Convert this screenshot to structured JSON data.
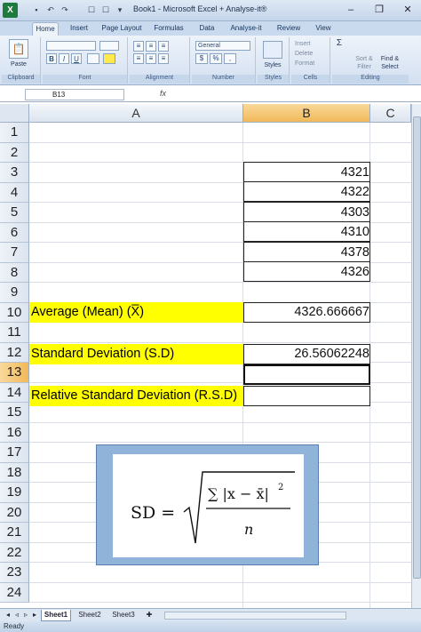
{
  "window": {
    "title": "Book1 - Microsoft Excel + Analyse-it®",
    "logo": "X"
  },
  "ribbon_tabs": [
    "Home",
    "Insert",
    "Page Layout",
    "Formulas",
    "Data",
    "Analyse-it",
    "Review",
    "View"
  ],
  "ribbon": {
    "clipboard": {
      "label": "Clipboard",
      "paste": "Paste"
    },
    "font": {
      "label": "Font",
      "bold": "B",
      "italic": "I",
      "underline": "U"
    },
    "alignment": {
      "label": "Alignment"
    },
    "number": {
      "label": "Number",
      "format": "General"
    },
    "styles": {
      "label": "Styles",
      "button": "Styles"
    },
    "cells": {
      "label": "Cells",
      "insert": "Insert",
      "delete": "Delete",
      "format": "Format"
    },
    "editing": {
      "label": "Editing",
      "sort": "Sort &\nFilter",
      "find": "Find &\nSelect"
    }
  },
  "formula_bar": {
    "name_box": "B13",
    "fx": "fx",
    "content": ""
  },
  "columns": [
    "A",
    "B",
    "C"
  ],
  "rows": [
    "1",
    "2",
    "3",
    "4",
    "5",
    "6",
    "7",
    "8",
    "9",
    "10",
    "11",
    "12",
    "13",
    "14",
    "15",
    "16",
    "17",
    "18",
    "19",
    "20",
    "21",
    "22",
    "23",
    "24"
  ],
  "selected": {
    "column": "B",
    "row": "13"
  },
  "cells": {
    "b3": "4321",
    "b4": "4322",
    "b5": "4303",
    "b6": "4310",
    "b7": "4378",
    "b8": "4326",
    "a10": "Average (Mean) (X̅)",
    "b10": "4326.666667",
    "a12": "Standard Deviation  (S.D)",
    "b12": "26.56062248",
    "a14": "Relative Standard Deviation (R.S.D)"
  },
  "formula_image": {
    "lhs": "SD =",
    "numerator": "∑ |x − x̄|",
    "exponent": "2",
    "denominator": "n"
  },
  "sheets": [
    "Sheet1",
    "Sheet2",
    "Sheet3"
  ],
  "active_sheet": "Sheet1",
  "status": {
    "ready": "Ready"
  },
  "colors": {
    "highlight": "#ffff00",
    "selected_header": "#f1b959",
    "formula_frame": "#8fb3d9"
  }
}
